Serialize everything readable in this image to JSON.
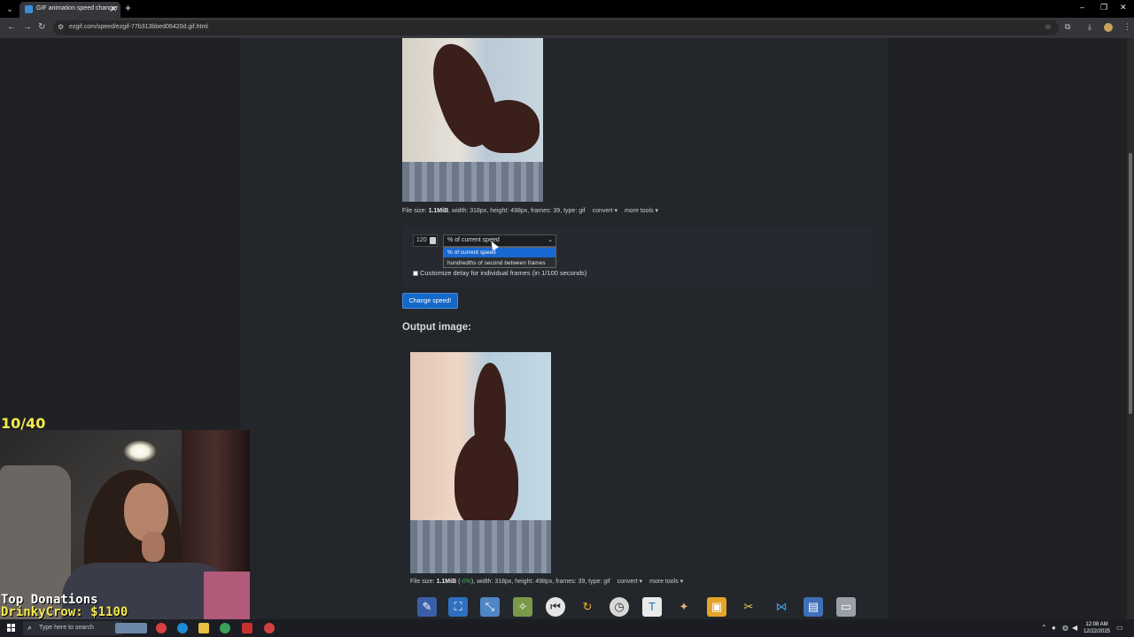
{
  "browser": {
    "tab_title": "GIF animation speed changer",
    "tab_close": "✕",
    "new_tab": "+",
    "url": "ezgif.com/speed/ezgif-77b313bbed06420d.gif.html",
    "nav_icons": [
      "back-arrow-icon",
      "forward-arrow-icon",
      "reload-icon"
    ],
    "toolbar_icons": [
      "bookmark-star-icon",
      "extensions-icon",
      "download-icon",
      "profile-icon",
      "menu-icon"
    ]
  },
  "input_image": {
    "info_prefix": "File size: ",
    "file_size": "1.1MiB",
    "info_rest": ", width: 318px, height: 498px, frames: 39, type: gif",
    "convert_label": "convert ▾",
    "more_tools_label": "more tools ▾"
  },
  "speed_form": {
    "value": "120",
    "unit_selected": "% of current speed",
    "unit_options": [
      "% of current speed",
      "hundredths of second between frames"
    ],
    "customize_label": "Customize delay for individual frames (in 1/100 seconds)",
    "submit_label": "Change speed!"
  },
  "output": {
    "title": "Output image:",
    "info_prefix": "File size: ",
    "file_size": "1.1MiB",
    "change": "-0%",
    "info_rest": ", width: 318px, height: 498px, frames: 39, type: gif",
    "convert_label": "convert ▾",
    "more_tools_label": "more tools ▾"
  },
  "stream_overlay": {
    "counter": "10/40",
    "donations_title": "Top Donations",
    "donor": "DrinkyCrow:",
    "amount": "$1100"
  },
  "taskbar": {
    "search_placeholder": "Type here to search",
    "time": "12:08 AM",
    "date": "12/22/2025"
  },
  "colors": {
    "accent_button": "#1468c8",
    "dropdown_highlight": "#1967d2",
    "counter_yellow": "#f5e94a",
    "positive_green": "#3fb950"
  }
}
